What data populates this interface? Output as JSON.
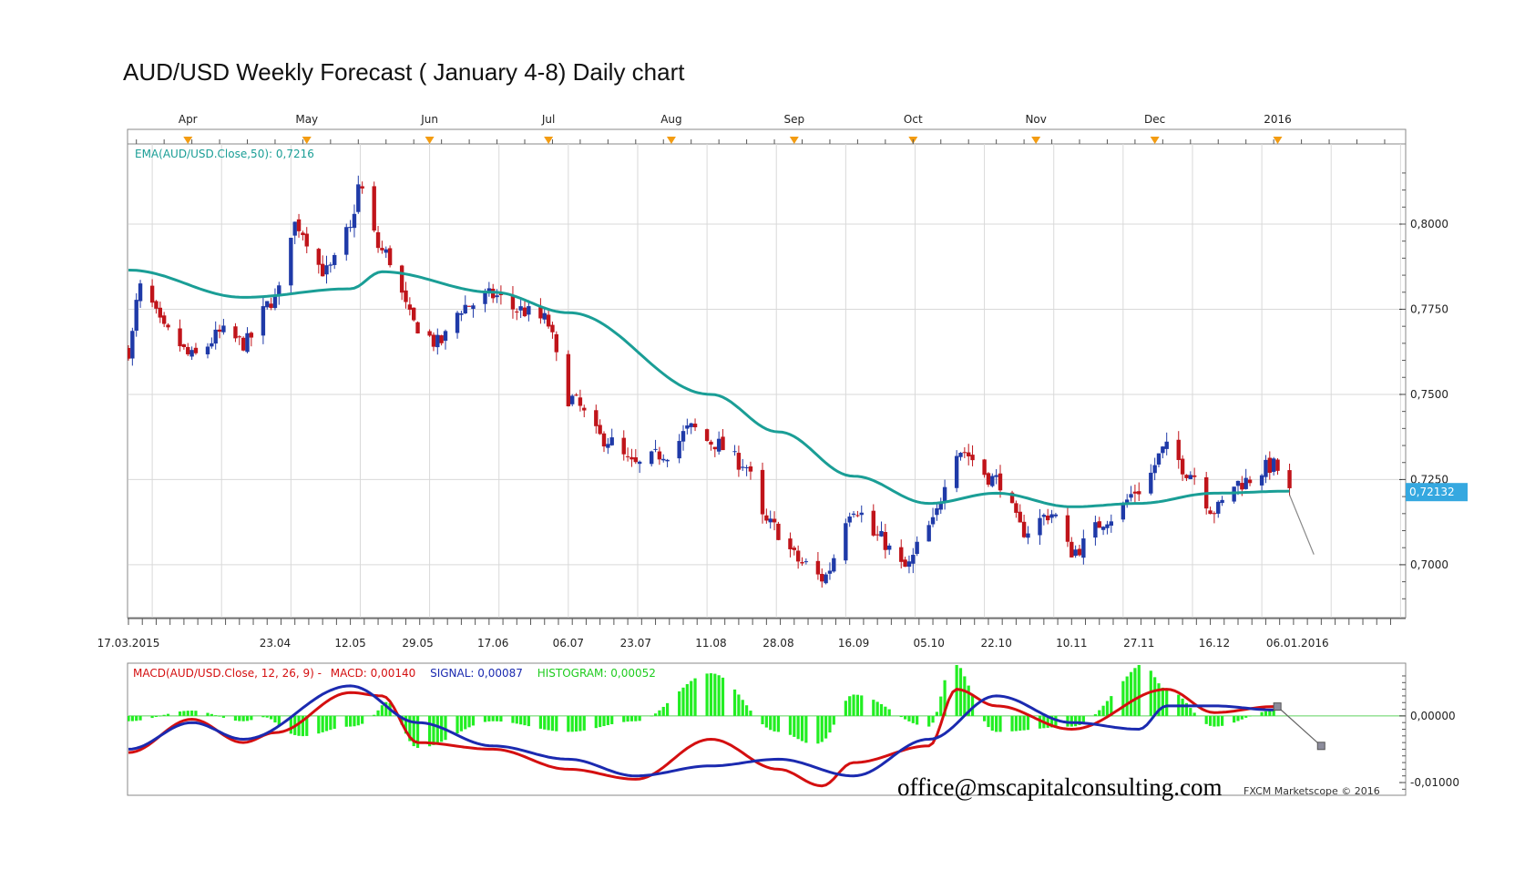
{
  "title": "AUD/USD Weekly Forecast ( January 4-8) Daily chart",
  "colors": {
    "bull": "#1f3aa8",
    "bear": "#c0141a",
    "ema": "#1a9e96",
    "macd": "#d40f10",
    "signal": "#1b2ab0",
    "histogram": "#22ee22",
    "price_tag": "#35a8e0",
    "grid": "#d9d9d9",
    "frame": "#8a8a8a",
    "month_marker": "#f39c12"
  },
  "chart_data": [
    {
      "type": "candlestick",
      "ema_label": "EMA(AUD/USD.Close,50): 0,7216",
      "price_tag": "0,72132",
      "y_ticks": [
        "0,8000",
        "0,7750",
        "0,7500",
        "0,7250",
        "0,7000"
      ],
      "y_tick_values": [
        0.8,
        0.775,
        0.75,
        0.725,
        0.7
      ],
      "ylim": [
        0.685,
        0.823
      ],
      "month_labels": [
        "Apr",
        "May",
        "Jun",
        "Jul",
        "Aug",
        "Sep",
        "Oct",
        "Nov",
        "Dec",
        "2016"
      ],
      "date_labels": [
        "17.03.2015",
        "23.04",
        "12.05",
        "29.05",
        "17.06",
        "06.07",
        "23.07",
        "11.08",
        "28.08",
        "16.09",
        "05.10",
        "22.10",
        "10.11",
        "27.11",
        "16.12",
        "06.01.2016"
      ],
      "close_anchors": [
        {
          "date": "17.03.2015",
          "close": 0.763
        },
        {
          "date": "20.03",
          "close": 0.781
        },
        {
          "date": "27.03",
          "close": 0.768
        },
        {
          "date": "02.04",
          "close": 0.761
        },
        {
          "date": "10.04",
          "close": 0.768
        },
        {
          "date": "15.04",
          "close": 0.765
        },
        {
          "date": "23.04",
          "close": 0.778
        },
        {
          "date": "28.04",
          "close": 0.8
        },
        {
          "date": "06.05",
          "close": 0.786
        },
        {
          "date": "12.05",
          "close": 0.798
        },
        {
          "date": "14.05",
          "close": 0.811
        },
        {
          "date": "20.05",
          "close": 0.792
        },
        {
          "date": "29.05",
          "close": 0.77
        },
        {
          "date": "03.06",
          "close": 0.765
        },
        {
          "date": "10.06",
          "close": 0.776
        },
        {
          "date": "17.06",
          "close": 0.779
        },
        {
          "date": "23.06",
          "close": 0.775
        },
        {
          "date": "30.06",
          "close": 0.772
        },
        {
          "date": "06.07",
          "close": 0.749
        },
        {
          "date": "15.07",
          "close": 0.737
        },
        {
          "date": "23.07",
          "close": 0.729
        },
        {
          "date": "31.07",
          "close": 0.733
        },
        {
          "date": "06.08",
          "close": 0.74
        },
        {
          "date": "11.08",
          "close": 0.736
        },
        {
          "date": "19.08",
          "close": 0.73
        },
        {
          "date": "25.08",
          "close": 0.712
        },
        {
          "date": "04.09",
          "close": 0.7
        },
        {
          "date": "08.09",
          "close": 0.696
        },
        {
          "date": "16.09",
          "close": 0.717
        },
        {
          "date": "22.09",
          "close": 0.708
        },
        {
          "date": "29.09",
          "close": 0.699
        },
        {
          "date": "05.10",
          "close": 0.711
        },
        {
          "date": "12.10",
          "close": 0.734
        },
        {
          "date": "22.10",
          "close": 0.725
        },
        {
          "date": "29.10",
          "close": 0.71
        },
        {
          "date": "05.11",
          "close": 0.715
        },
        {
          "date": "10.11",
          "close": 0.704
        },
        {
          "date": "20.11",
          "close": 0.714
        },
        {
          "date": "27.11",
          "close": 0.722
        },
        {
          "date": "04.12",
          "close": 0.734
        },
        {
          "date": "10.12",
          "close": 0.727
        },
        {
          "date": "16.12",
          "close": 0.716
        },
        {
          "date": "22.12",
          "close": 0.724
        },
        {
          "date": "31.12",
          "close": 0.729
        },
        {
          "date": "04.01.2016",
          "close": 0.721
        },
        {
          "date": "06.01.2016",
          "close": 0.703
        }
      ],
      "ema_anchors": [
        {
          "date": "17.03.2015",
          "value": 0.7865
        },
        {
          "date": "15.04",
          "value": 0.7785
        },
        {
          "date": "12.05",
          "value": 0.781
        },
        {
          "date": "20.05",
          "value": 0.786
        },
        {
          "date": "17.06",
          "value": 0.78
        },
        {
          "date": "06.07",
          "value": 0.774
        },
        {
          "date": "11.08",
          "value": 0.75
        },
        {
          "date": "28.08",
          "value": 0.739
        },
        {
          "date": "16.09",
          "value": 0.726
        },
        {
          "date": "05.10",
          "value": 0.718
        },
        {
          "date": "22.10",
          "value": 0.721
        },
        {
          "date": "10.11",
          "value": 0.717
        },
        {
          "date": "27.11",
          "value": 0.718
        },
        {
          "date": "16.12",
          "value": 0.721
        },
        {
          "date": "04.01.2016",
          "value": 0.7216
        }
      ]
    },
    {
      "type": "macd",
      "label_macd_prefix": "MACD(AUD/USD.Close, 12, 26, 9) -",
      "label_macd": "MACD: 0,00140",
      "label_signal": "SIGNAL: 0,00087",
      "label_histogram": "HISTOGRAM: 0,00052",
      "y_ticks": [
        "0,00000",
        "-0,01000"
      ],
      "y_tick_values": [
        0,
        -0.01
      ],
      "ylim": [
        -0.0115,
        0.0075
      ],
      "macd_anchors": [
        {
          "date": "17.03.2015",
          "value": -0.0055
        },
        {
          "date": "02.04",
          "value": -0.0005
        },
        {
          "date": "15.04",
          "value": -0.004
        },
        {
          "date": "23.04",
          "value": -0.0025
        },
        {
          "date": "12.05",
          "value": 0.0035
        },
        {
          "date": "20.05",
          "value": 0.003
        },
        {
          "date": "29.05",
          "value": -0.004
        },
        {
          "date": "17.06",
          "value": -0.005
        },
        {
          "date": "06.07",
          "value": -0.008
        },
        {
          "date": "23.07",
          "value": -0.0095
        },
        {
          "date": "11.08",
          "value": -0.0035
        },
        {
          "date": "28.08",
          "value": -0.008
        },
        {
          "date": "08.09",
          "value": -0.0105
        },
        {
          "date": "16.09",
          "value": -0.007
        },
        {
          "date": "05.10",
          "value": -0.0045
        },
        {
          "date": "12.10",
          "value": 0.004
        },
        {
          "date": "22.10",
          "value": 0.0015
        },
        {
          "date": "10.11",
          "value": -0.002
        },
        {
          "date": "04.12",
          "value": 0.004
        },
        {
          "date": "16.12",
          "value": 0.0005
        },
        {
          "date": "31.12",
          "value": 0.0014
        },
        {
          "date": "06.01.2016",
          "value": -0.0045
        }
      ],
      "signal_anchors": [
        {
          "date": "17.03.2015",
          "value": -0.005
        },
        {
          "date": "02.04",
          "value": -0.001
        },
        {
          "date": "15.04",
          "value": -0.0035
        },
        {
          "date": "12.05",
          "value": 0.0045
        },
        {
          "date": "29.05",
          "value": -0.001
        },
        {
          "date": "17.06",
          "value": -0.0045
        },
        {
          "date": "06.07",
          "value": -0.0065
        },
        {
          "date": "23.07",
          "value": -0.009
        },
        {
          "date": "11.08",
          "value": -0.0075
        },
        {
          "date": "28.08",
          "value": -0.0065
        },
        {
          "date": "16.09",
          "value": -0.009
        },
        {
          "date": "05.10",
          "value": -0.0035
        },
        {
          "date": "22.10",
          "value": 0.003
        },
        {
          "date": "10.11",
          "value": -0.001
        },
        {
          "date": "27.11",
          "value": -0.002
        },
        {
          "date": "04.12",
          "value": 0.0015
        },
        {
          "date": "16.12",
          "value": 0.0015
        },
        {
          "date": "31.12",
          "value": 0.0009
        },
        {
          "date": "06.01.2016",
          "value": -0.0045
        }
      ]
    }
  ],
  "watermark": "office@mscapitalconsulting.com",
  "copyright": "FXCM Marketscope © 2016"
}
